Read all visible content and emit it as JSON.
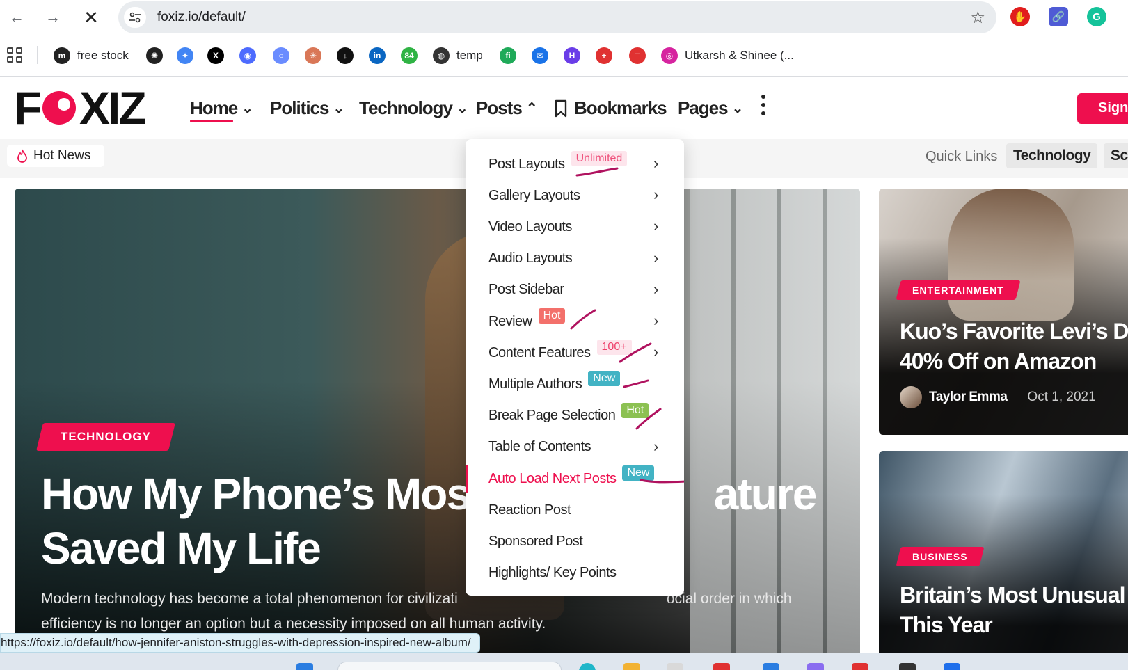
{
  "browser": {
    "url": "foxiz.io/default/",
    "extensions": [
      "adblock-icon",
      "link-icon",
      "grammarly-icon"
    ]
  },
  "bookmarks": [
    {
      "label": "free stock",
      "icon": "m",
      "color": "#222222"
    },
    {
      "label": "",
      "icon": "openai-icon",
      "color": "#222222"
    },
    {
      "label": "",
      "icon": "gemini-icon",
      "color": "#4285f4"
    },
    {
      "label": "",
      "icon": "x-icon",
      "color": "#000000"
    },
    {
      "label": "",
      "icon": "deepseek-icon",
      "color": "#4d6bfe"
    },
    {
      "label": "",
      "icon": "ring-icon",
      "color": "#6a8cff"
    },
    {
      "label": "",
      "icon": "claude-icon",
      "color": "#d97757"
    },
    {
      "label": "",
      "icon": "download-icon",
      "color": "#111111"
    },
    {
      "label": "",
      "icon": "linkedin-icon",
      "color": "#0a66c2"
    },
    {
      "label": "",
      "icon": "84-icon",
      "color": "#2fb344"
    },
    {
      "label": "temp",
      "icon": "globe-icon",
      "color": "#333333"
    },
    {
      "label": "",
      "icon": "fi-icon",
      "color": "#1faa59"
    },
    {
      "label": "",
      "icon": "inbox-icon",
      "color": "#1a73e8"
    },
    {
      "label": "",
      "icon": "h-icon",
      "color": "#6a3de8"
    },
    {
      "label": "",
      "icon": "plus-icon",
      "color": "#e03131"
    },
    {
      "label": "",
      "icon": "square-icon",
      "color": "#e03131"
    },
    {
      "label": "Utkarsh & Shinee (...",
      "icon": "instagram-icon",
      "color": "#d6249f"
    }
  ],
  "site": {
    "logo_text": "FOXIZ",
    "brand_color": "#ee0f4e",
    "nav": [
      {
        "label": "Home",
        "chevron": "⌄"
      },
      {
        "label": "Politics",
        "chevron": "⌄"
      },
      {
        "label": "Technology",
        "chevron": "⌄"
      },
      {
        "label": "Posts",
        "chevron": "⌃"
      },
      {
        "label": "Bookmarks",
        "chevron": ""
      },
      {
        "label": "Pages",
        "chevron": "⌄"
      }
    ],
    "sign_in_label": "Sign I"
  },
  "subbar": {
    "hot_news": "Hot News",
    "quick_links": "Quick Links",
    "chips": [
      "Technology",
      "Sci"
    ]
  },
  "hero": {
    "category": "TECHNOLOGY",
    "title_line1": "How My Phone’s Most /",
    "title_line1_end": "ature",
    "title_line2": "Saved My Life",
    "desc_line1": "Modern technology has become a total phenomenon for civilizati",
    "desc_line1_end": "ocial order in which",
    "desc_line2": "efficiency is no longer an option but a necessity imposed on all human activity."
  },
  "cards": [
    {
      "category": "ENTERTAINMENT",
      "title_line1": "Kuo’s Favorite Levi’s Der",
      "title_line2": "40% Off on Amazon",
      "author": "Taylor Emma",
      "date": "Oct 1, 2021"
    },
    {
      "category": "BUSINESS",
      "title_line1": "Britain’s Most Unusual H",
      "title_line2": "This Year"
    }
  ],
  "posts_menu": [
    {
      "label": "Post Layouts",
      "tag": "Unlimited",
      "tag_style": "unlimited",
      "arrow": "›"
    },
    {
      "label": "Gallery Layouts",
      "tag": "",
      "tag_style": "",
      "arrow": "›"
    },
    {
      "label": "Video Layouts",
      "tag": "",
      "tag_style": "",
      "arrow": "›"
    },
    {
      "label": "Audio Layouts",
      "tag": "",
      "tag_style": "",
      "arrow": "›"
    },
    {
      "label": "Post Sidebar",
      "tag": "",
      "tag_style": "",
      "arrow": "›"
    },
    {
      "label": "Review",
      "tag": "Hot",
      "tag_style": "hot-red",
      "arrow": "›"
    },
    {
      "label": "Content Features",
      "tag": "100+",
      "tag_style": "100",
      "arrow": "›"
    },
    {
      "label": "Multiple Authors",
      "tag": "New",
      "tag_style": "new-teal",
      "arrow": ""
    },
    {
      "label": "Break Page Selection",
      "tag": "Hot",
      "tag_style": "hot-green",
      "arrow": ""
    },
    {
      "label": "Table of Contents",
      "tag": "",
      "tag_style": "",
      "arrow": "›"
    },
    {
      "label": "Auto Load Next Posts",
      "tag": "New",
      "tag_style": "new-teal",
      "arrow": "",
      "active": true
    },
    {
      "label": "Reaction Post",
      "tag": "",
      "tag_style": "",
      "arrow": ""
    },
    {
      "label": "Sponsored Post",
      "tag": "",
      "tag_style": "",
      "arrow": ""
    },
    {
      "label": "Highlights/ Key Points",
      "tag": "",
      "tag_style": "",
      "arrow": ""
    }
  ],
  "status_url": "https://foxiz.io/default/how-jennifer-aniston-struggles-with-depression-inspired-new-album/"
}
